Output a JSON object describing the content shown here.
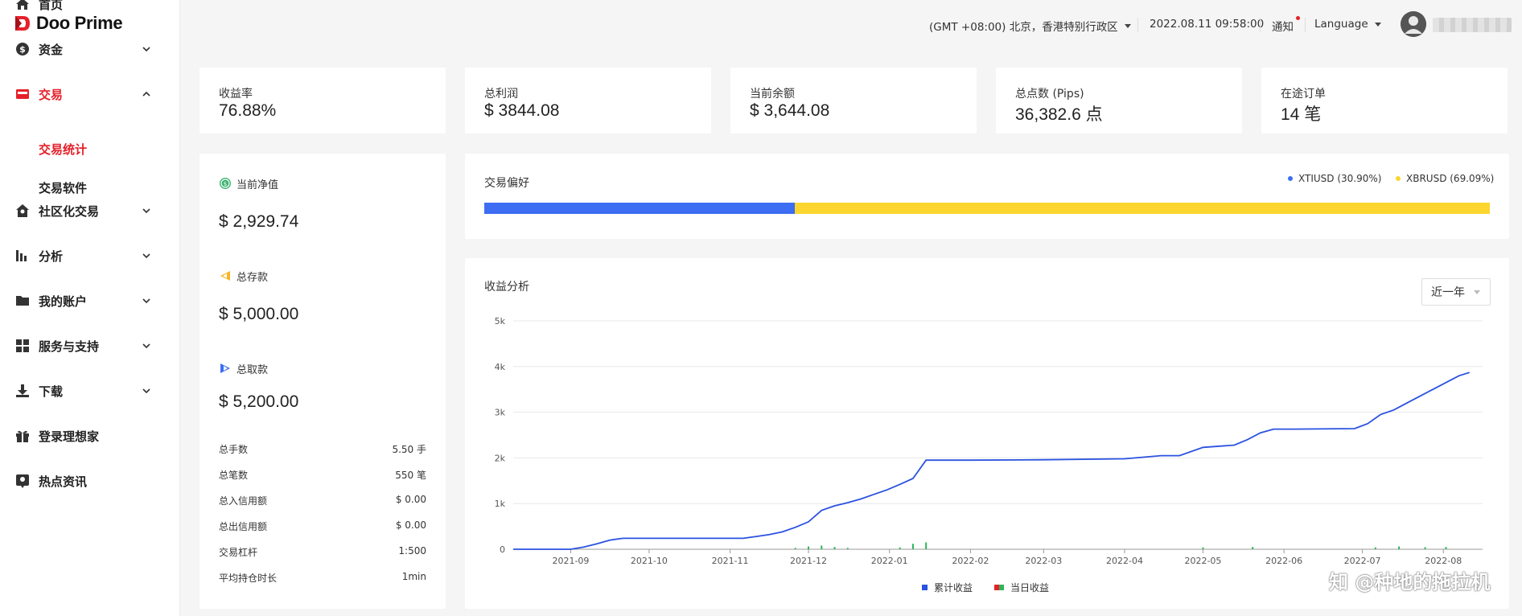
{
  "brand": {
    "name": "Doo Prime"
  },
  "sidebar": {
    "items": [
      {
        "label": "首页",
        "icon": "home-icon",
        "expand": "none"
      },
      {
        "label": "资金",
        "icon": "dollar-coin-icon",
        "expand": "down"
      },
      {
        "label": "交易",
        "icon": "trade-card-icon",
        "expand": "up",
        "active": true
      },
      {
        "label": "社区化交易",
        "icon": "community-house-icon",
        "expand": "down"
      },
      {
        "label": "分析",
        "icon": "bar-chart-icon",
        "expand": "down"
      },
      {
        "label": "我的账户",
        "icon": "folder-icon",
        "expand": "down"
      },
      {
        "label": "服务与支持",
        "icon": "grid-icon",
        "expand": "down"
      },
      {
        "label": "下载",
        "icon": "download-icon",
        "expand": "down"
      },
      {
        "label": "登录理想家",
        "icon": "gift-icon",
        "expand": "none"
      },
      {
        "label": "热点资讯",
        "icon": "news-pin-icon",
        "expand": "none"
      }
    ],
    "trade_sub": [
      {
        "label": "交易统计",
        "active": true
      },
      {
        "label": "交易软件",
        "active": false
      }
    ]
  },
  "header": {
    "timezone": "(GMT +08:00) 北京，香港特别行政区",
    "datetime": "2022.08.11 09:58:00",
    "notifications": "通知",
    "language": "Language"
  },
  "stats": [
    {
      "label": "收益率",
      "value": "76.88%"
    },
    {
      "label": "总利润",
      "value": "$ 3844.08"
    },
    {
      "label": "当前余额",
      "value": "$ 3,644.08"
    },
    {
      "label": "总点数 (Pips)",
      "value": "36,382.6 点"
    },
    {
      "label": "在途订单",
      "value": "14 笔"
    }
  ],
  "summary": {
    "equity": {
      "label": "当前净值",
      "value": "$ 2,929.74"
    },
    "deposit": {
      "label": "总存款",
      "value": "$ 5,000.00"
    },
    "withdraw": {
      "label": "总取款",
      "value": "$ 5,200.00"
    },
    "rows": [
      {
        "k": "总手数",
        "v": "5.50 手"
      },
      {
        "k": "总笔数",
        "v": "550 笔"
      },
      {
        "k": "总入信用额",
        "v": "$ 0.00"
      },
      {
        "k": "总出信用额",
        "v": "$ 0.00"
      },
      {
        "k": "交易杠杆",
        "v": "1:500"
      },
      {
        "k": "平均持仓时长",
        "v": "1min"
      }
    ]
  },
  "preference": {
    "title": "交易偏好",
    "items": [
      {
        "label": "XTIUSD (30.90%)",
        "share": 30.9,
        "color": "#3d6df2"
      },
      {
        "label": "XBRUSD (69.09%)",
        "share": 69.09,
        "color": "#fcd62f"
      }
    ]
  },
  "profit": {
    "title": "收益分析",
    "range": "近一年",
    "legend": [
      "累计收益",
      "当日收益"
    ]
  },
  "colors": {
    "accent": "#e5202a",
    "line": "#2a52e0",
    "daily_pos": "#2fb45a",
    "daily_neg": "#e5202a"
  },
  "chart_data": {
    "type": "line",
    "title": "收益分析",
    "ylim": [
      0,
      5000
    ],
    "yticks": [
      "0",
      "1k",
      "2k",
      "3k",
      "4k",
      "5k"
    ],
    "xticks": [
      "2021-09",
      "2021-10",
      "2021-11",
      "2021-12",
      "2022-01",
      "2022-02",
      "2022-03",
      "2022-04",
      "2022-05",
      "2022-06",
      "2022-07",
      "2022-08"
    ],
    "grid": true,
    "legend_position": "bottom",
    "series": [
      {
        "name": "累计收益",
        "x": [
          "2021-08-10",
          "2021-09-01",
          "2021-09-06",
          "2021-09-11",
          "2021-09-16",
          "2021-09-21",
          "2021-09-26",
          "2021-10-16",
          "2021-11-06",
          "2021-11-11",
          "2021-11-16",
          "2021-11-21",
          "2021-11-26",
          "2021-12-01",
          "2021-12-06",
          "2021-12-11",
          "2021-12-16",
          "2021-12-21",
          "2021-12-26",
          "2021-12-31",
          "2022-01-05",
          "2022-01-10",
          "2022-01-15",
          "2022-01-20",
          "2022-02-01",
          "2022-03-01",
          "2022-04-01",
          "2022-04-15",
          "2022-04-22",
          "2022-05-01",
          "2022-05-13",
          "2022-05-18",
          "2022-05-23",
          "2022-05-28",
          "2022-06-05",
          "2022-06-28",
          "2022-07-03",
          "2022-07-08",
          "2022-07-13",
          "2022-07-18",
          "2022-07-23",
          "2022-07-28",
          "2022-08-02",
          "2022-08-07",
          "2022-08-11"
        ],
        "y": [
          0,
          0,
          50,
          120,
          200,
          240,
          240,
          240,
          240,
          280,
          320,
          380,
          480,
          600,
          850,
          950,
          1020,
          1100,
          1200,
          1300,
          1420,
          1550,
          1950,
          1950,
          1950,
          1960,
          1980,
          2050,
          2050,
          2230,
          2280,
          2400,
          2550,
          2630,
          2630,
          2640,
          2750,
          2950,
          3050,
          3200,
          3350,
          3500,
          3650,
          3800,
          3870
        ]
      },
      {
        "name": "当日收益",
        "x": [
          "2021-11-26",
          "2021-12-01",
          "2021-12-06",
          "2021-12-11",
          "2021-12-16",
          "2022-01-05",
          "2022-01-10",
          "2022-01-15",
          "2022-05-01",
          "2022-05-20",
          "2022-07-06",
          "2022-07-15",
          "2022-07-25",
          "2022-08-02"
        ],
        "y": [
          30,
          60,
          80,
          50,
          30,
          40,
          120,
          150,
          40,
          50,
          40,
          60,
          45,
          50
        ]
      }
    ]
  }
}
